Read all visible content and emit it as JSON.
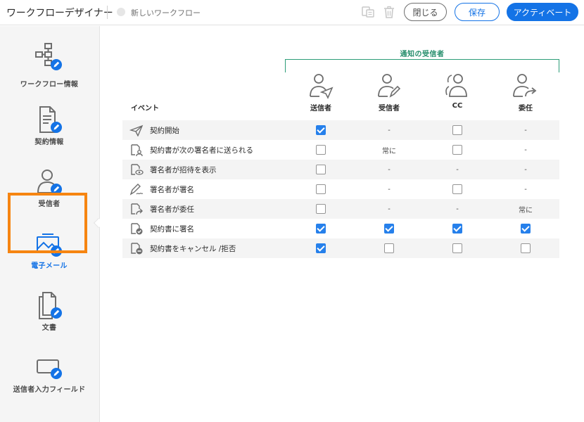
{
  "header": {
    "app_title": "ワークフローデザイナー",
    "workflow_name": "新しいワークフロー",
    "close_label": "閉じる",
    "save_label": "保存",
    "activate_label": "アクティベート"
  },
  "sidebar": {
    "items": [
      {
        "label": "ワークフロー情報",
        "icon": "workflow-info-icon"
      },
      {
        "label": "契約情報",
        "icon": "agreement-info-icon"
      },
      {
        "label": "受信者",
        "icon": "recipients-icon"
      },
      {
        "label": "電子メール",
        "icon": "email-icon",
        "active": true
      },
      {
        "label": "文書",
        "icon": "documents-icon"
      },
      {
        "label": "送信者入力フィールド",
        "icon": "sender-input-fields-icon"
      }
    ]
  },
  "table": {
    "group_label": "通知の受信者",
    "event_header": "イベント",
    "columns": [
      {
        "label": "送信者",
        "icon": "sender-icon"
      },
      {
        "label": "受信者",
        "icon": "recipient-icon"
      },
      {
        "label": "CC",
        "icon": "cc-icon"
      },
      {
        "label": "委任",
        "icon": "delegate-icon"
      }
    ],
    "rows": [
      {
        "event": "契約開始",
        "icon": "send-icon",
        "cells": [
          "checked",
          "-",
          "unchecked",
          "-"
        ]
      },
      {
        "event": "契約書が次の署名者に送られる",
        "icon": "next-signer-icon",
        "cells": [
          "unchecked",
          "常に",
          "unchecked",
          "-"
        ]
      },
      {
        "event": "署名者が招待を表示",
        "icon": "view-invite-icon",
        "cells": [
          "unchecked",
          "-",
          "-",
          "-"
        ]
      },
      {
        "event": "署名者が署名",
        "icon": "signed-icon",
        "cells": [
          "unchecked",
          "-",
          "unchecked",
          "-"
        ]
      },
      {
        "event": "署名者が委任",
        "icon": "delegated-icon",
        "cells": [
          "unchecked",
          "-",
          "-",
          "常に"
        ]
      },
      {
        "event": "契約書に署名",
        "icon": "agreement-signed-icon",
        "cells": [
          "checked",
          "checked",
          "checked",
          "checked"
        ]
      },
      {
        "event": "契約書をキャンセル /拒否",
        "icon": "cancel-decline-icon",
        "cells": [
          "checked",
          "unchecked",
          "unchecked",
          "unchecked"
        ]
      }
    ]
  },
  "colors": {
    "accent": "#1473e6",
    "checkbox_on": "#2680eb",
    "group_green": "#2d9d78",
    "active_frame": "#f68511"
  }
}
